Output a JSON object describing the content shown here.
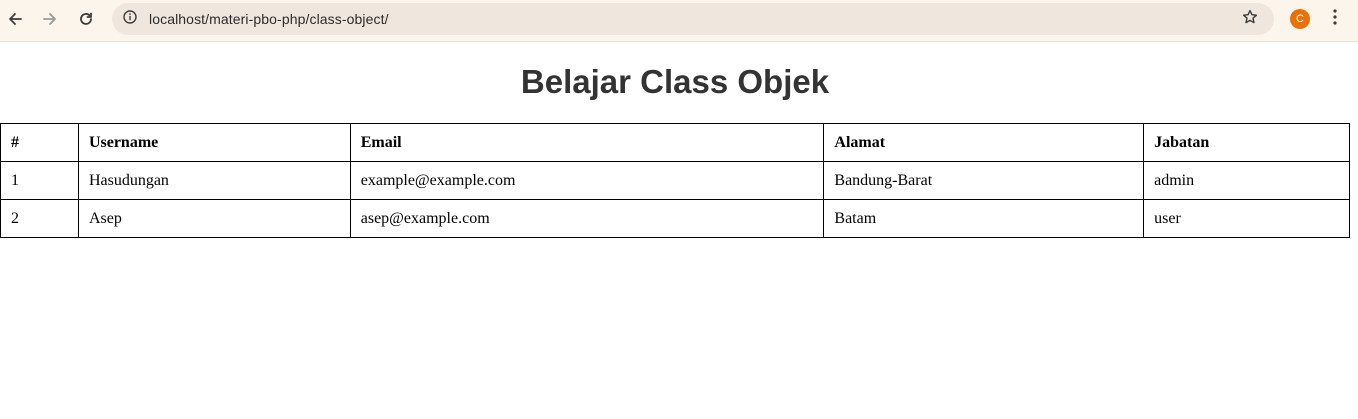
{
  "browser": {
    "url": "localhost/materi-pbo-php/class-object/",
    "profile_initial": "C",
    "icons": {
      "back": "arrow-left-icon",
      "forward": "arrow-right-icon",
      "reload": "reload-icon",
      "site_info": "info-icon",
      "bookmark": "star-icon",
      "menu": "more-vertical-icon"
    },
    "colors": {
      "toolbar_bg": "#fcf5ec",
      "omnibox_bg": "#efe7dd",
      "avatar_bg": "#e8710a"
    }
  },
  "page": {
    "title": "Belajar Class Objek",
    "table": {
      "headers": [
        "#",
        "Username",
        "Email",
        "Alamat",
        "Jabatan"
      ],
      "rows": [
        [
          "1",
          "Hasudungan",
          "example@example.com",
          "Bandung-Barat",
          "admin"
        ],
        [
          "2",
          "Asep",
          "asep@example.com",
          "Batam",
          "user"
        ]
      ]
    }
  }
}
